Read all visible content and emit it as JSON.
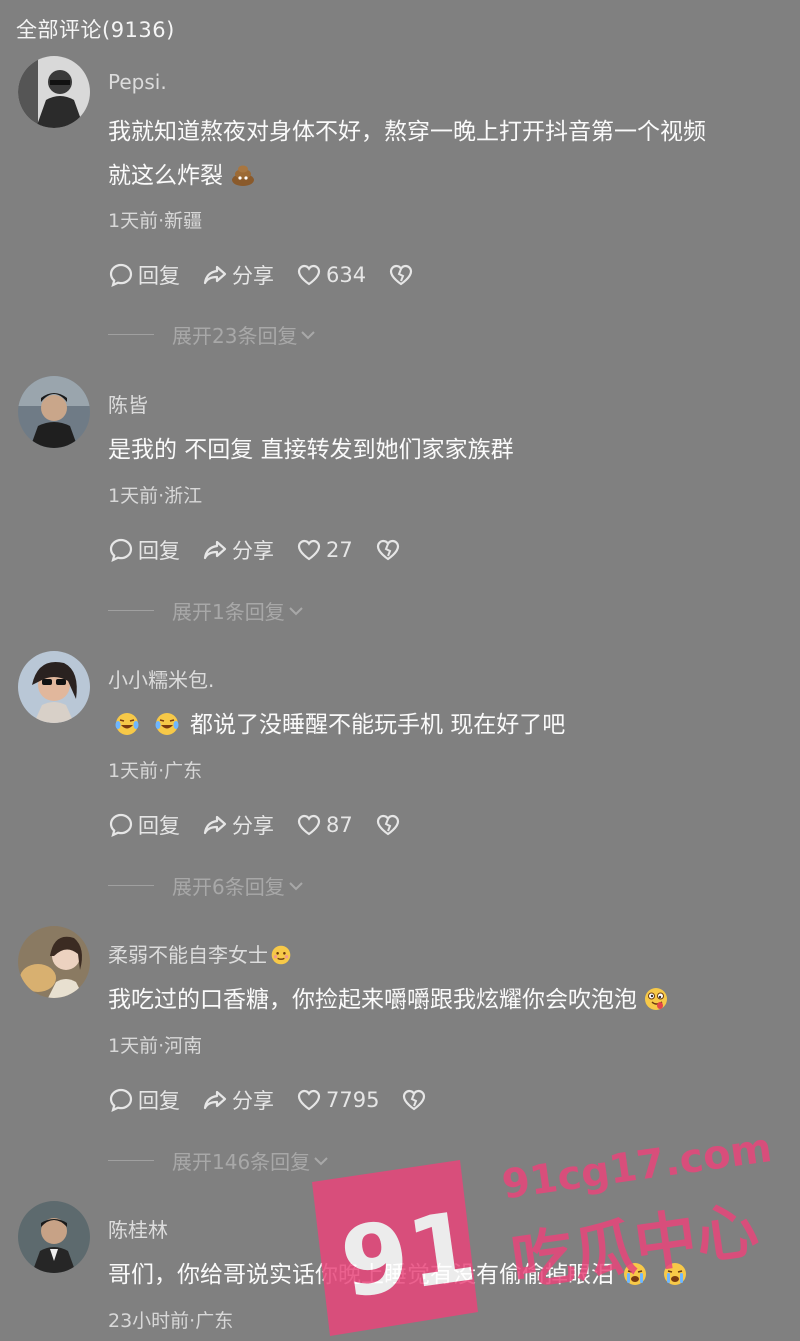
{
  "header": {
    "title": "全部评论(9136)"
  },
  "action_labels": {
    "reply": "回复",
    "share": "分享"
  },
  "comments": [
    {
      "username": "Pepsi.",
      "text_line1": "我就知道熬夜对身体不好，熬穿一晚上打开抖音第一个视频",
      "text_line2": "就这么炸裂",
      "meta": "1天前·新疆",
      "likes": "634",
      "expand": "展开23条回复"
    },
    {
      "username": "陈皆",
      "text_line1": "是我的 不回复 直接转发到她们家家族群",
      "meta": "1天前·浙江",
      "likes": "27",
      "expand": "展开1条回复"
    },
    {
      "username": "小小糯米包.",
      "text_line1": "都说了没睡醒不能玩手机 现在好了吧",
      "meta": "1天前·广东",
      "likes": "87",
      "expand": "展开6条回复"
    },
    {
      "username": "柔弱不能自李女士",
      "text_line1": "我吃过的口香糖，你捡起来嚼嚼跟我炫耀你会吹泡泡",
      "meta": "1天前·河南",
      "likes": "7795",
      "expand": "展开146条回复"
    },
    {
      "username": "陈桂林",
      "text_line1": "哥们，你给哥说实话你晚上睡觉有没有偷偷掉眼泪",
      "meta": "23小时前·广东"
    }
  ],
  "watermark": {
    "number": "91",
    "site": "91cg17.com",
    "brand": "吃瓜中心",
    "color": "#e8457a"
  },
  "icons": [
    "comment-bubble-icon",
    "share-arrow-icon",
    "heart-icon",
    "broken-heart-icon",
    "chevron-down-icon"
  ]
}
